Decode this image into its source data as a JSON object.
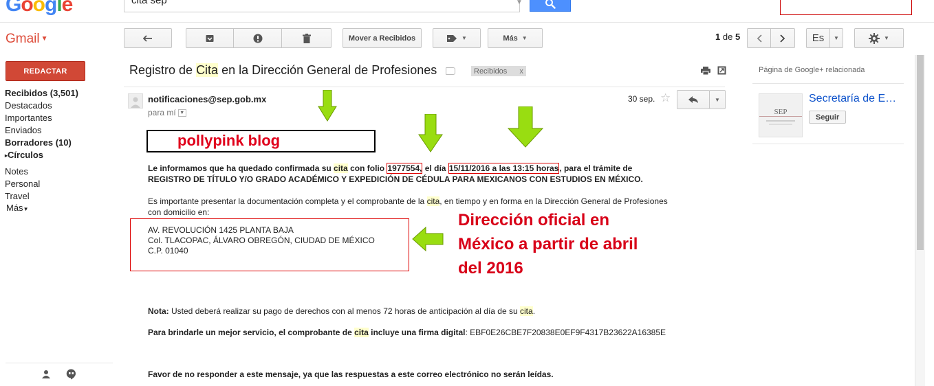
{
  "top": {
    "logo_g": "G",
    "logo_o1": "o",
    "logo_o2": "o",
    "logo_g2": "g",
    "logo_l": "l",
    "logo_e": "e",
    "search_value": "cita sep"
  },
  "gmail_label": "Gmail",
  "toolbar": {
    "move_to_inbox": "Mover a Recibidos",
    "more": "Más",
    "pager_start": "1",
    "pager_of": "de",
    "pager_total": "5",
    "lang": "Es"
  },
  "sidebar": {
    "compose": "REDACTAR",
    "items": [
      {
        "label": "Recibidos (3,501)"
      },
      {
        "label": "Destacados"
      },
      {
        "label": "Importantes"
      },
      {
        "label": "Enviados"
      },
      {
        "label": "Borradores (10)"
      },
      {
        "label": "Círculos"
      },
      {
        "label": "Notes"
      },
      {
        "label": "Personal"
      },
      {
        "label": "Travel"
      },
      {
        "label": "Más"
      }
    ]
  },
  "message": {
    "subject_1": "Registro de ",
    "subject_hl": "Cita",
    "subject_2": " en la Dirección General de Profesiones",
    "inbox_badge": "Recibidos",
    "badge_x": "x",
    "sender": "notificaciones@sep.gob.mx",
    "recipient": "para mí",
    "date": "30 sep.",
    "blog": "pollypink blog",
    "p1_a": "Le informamos que ha quedado confirmada su ",
    "p1_cita": "cita",
    "p1_b": " con folio ",
    "p1_folio": "1977554,",
    "p1_c": " el día ",
    "p1_fecha": "15/11/2016 a las 13:15 horas",
    "p1_d": ", para el trámite de",
    "p1_line2": "REGISTRO DE TÍTULO Y/O GRADO ACADÉMICO Y EXPEDICIÓN DE CÉDULA PARA MEXICANOS CON ESTUDIOS EN MÉXICO.",
    "p2_a": "Es importante presentar la documentación completa y el comprobante de la ",
    "p2_cita": "cita",
    "p2_b": ", en tiempo y en forma en la Dirección General de Profesiones",
    "p2_line2": "con domicilio en:",
    "addr_1": "AV. REVOLUCIÓN 1425 PLANTA BAJA",
    "addr_2": "Col. TLACOPAC, ÁLVARO OBREGÓN, CIUDAD DE MÉXICO",
    "addr_3": "C.P. 01040",
    "dir_note_1": "Dirección oficial en",
    "dir_note_2": "México a partir de abril",
    "dir_note_3": "del 2016",
    "nota_label": "Nota:",
    "nota_text": " Usted deberá realizar su pago de derechos con al menos 72 horas de anticipación al día de su ",
    "nota_cita": "cita",
    "nota_end": ".",
    "firma_a": "Para brindarle un mejor servicio, el comprobante de ",
    "firma_cita": "cita",
    "firma_b": " incluye una firma digital",
    "firma_value": ": EBF0E26CBE7F20838E0EF9F4317B23622A16385E",
    "footer": "Favor de no responder a este mensaje, ya que las respuestas a este correo electrónico no serán leídas."
  },
  "right_panel": {
    "title": "Página de Google+ relacionada",
    "name": "Secretaría de Educación Pública",
    "logo_text": "SEP",
    "follow": "Seguir"
  },
  "colors": {
    "gmail_red": "#dd4b39",
    "compose_red": "#d14836",
    "search_blue": "#4d90fe",
    "annotation_red": "#d80018",
    "arrow_green": "#99dd11",
    "highlight": "#ffffcc",
    "link_blue": "#1155cc"
  },
  "icons": [
    "search-icon",
    "reply-all-icon",
    "archive-icon",
    "report-spam-icon",
    "trash-icon",
    "label-icon",
    "chevron-left-icon",
    "chevron-right-icon",
    "gear-icon",
    "print-icon",
    "new-window-icon",
    "star-icon",
    "reply-icon",
    "contacts-icon",
    "hangouts-icon",
    "arrow-down-icon",
    "arrow-left-icon"
  ]
}
